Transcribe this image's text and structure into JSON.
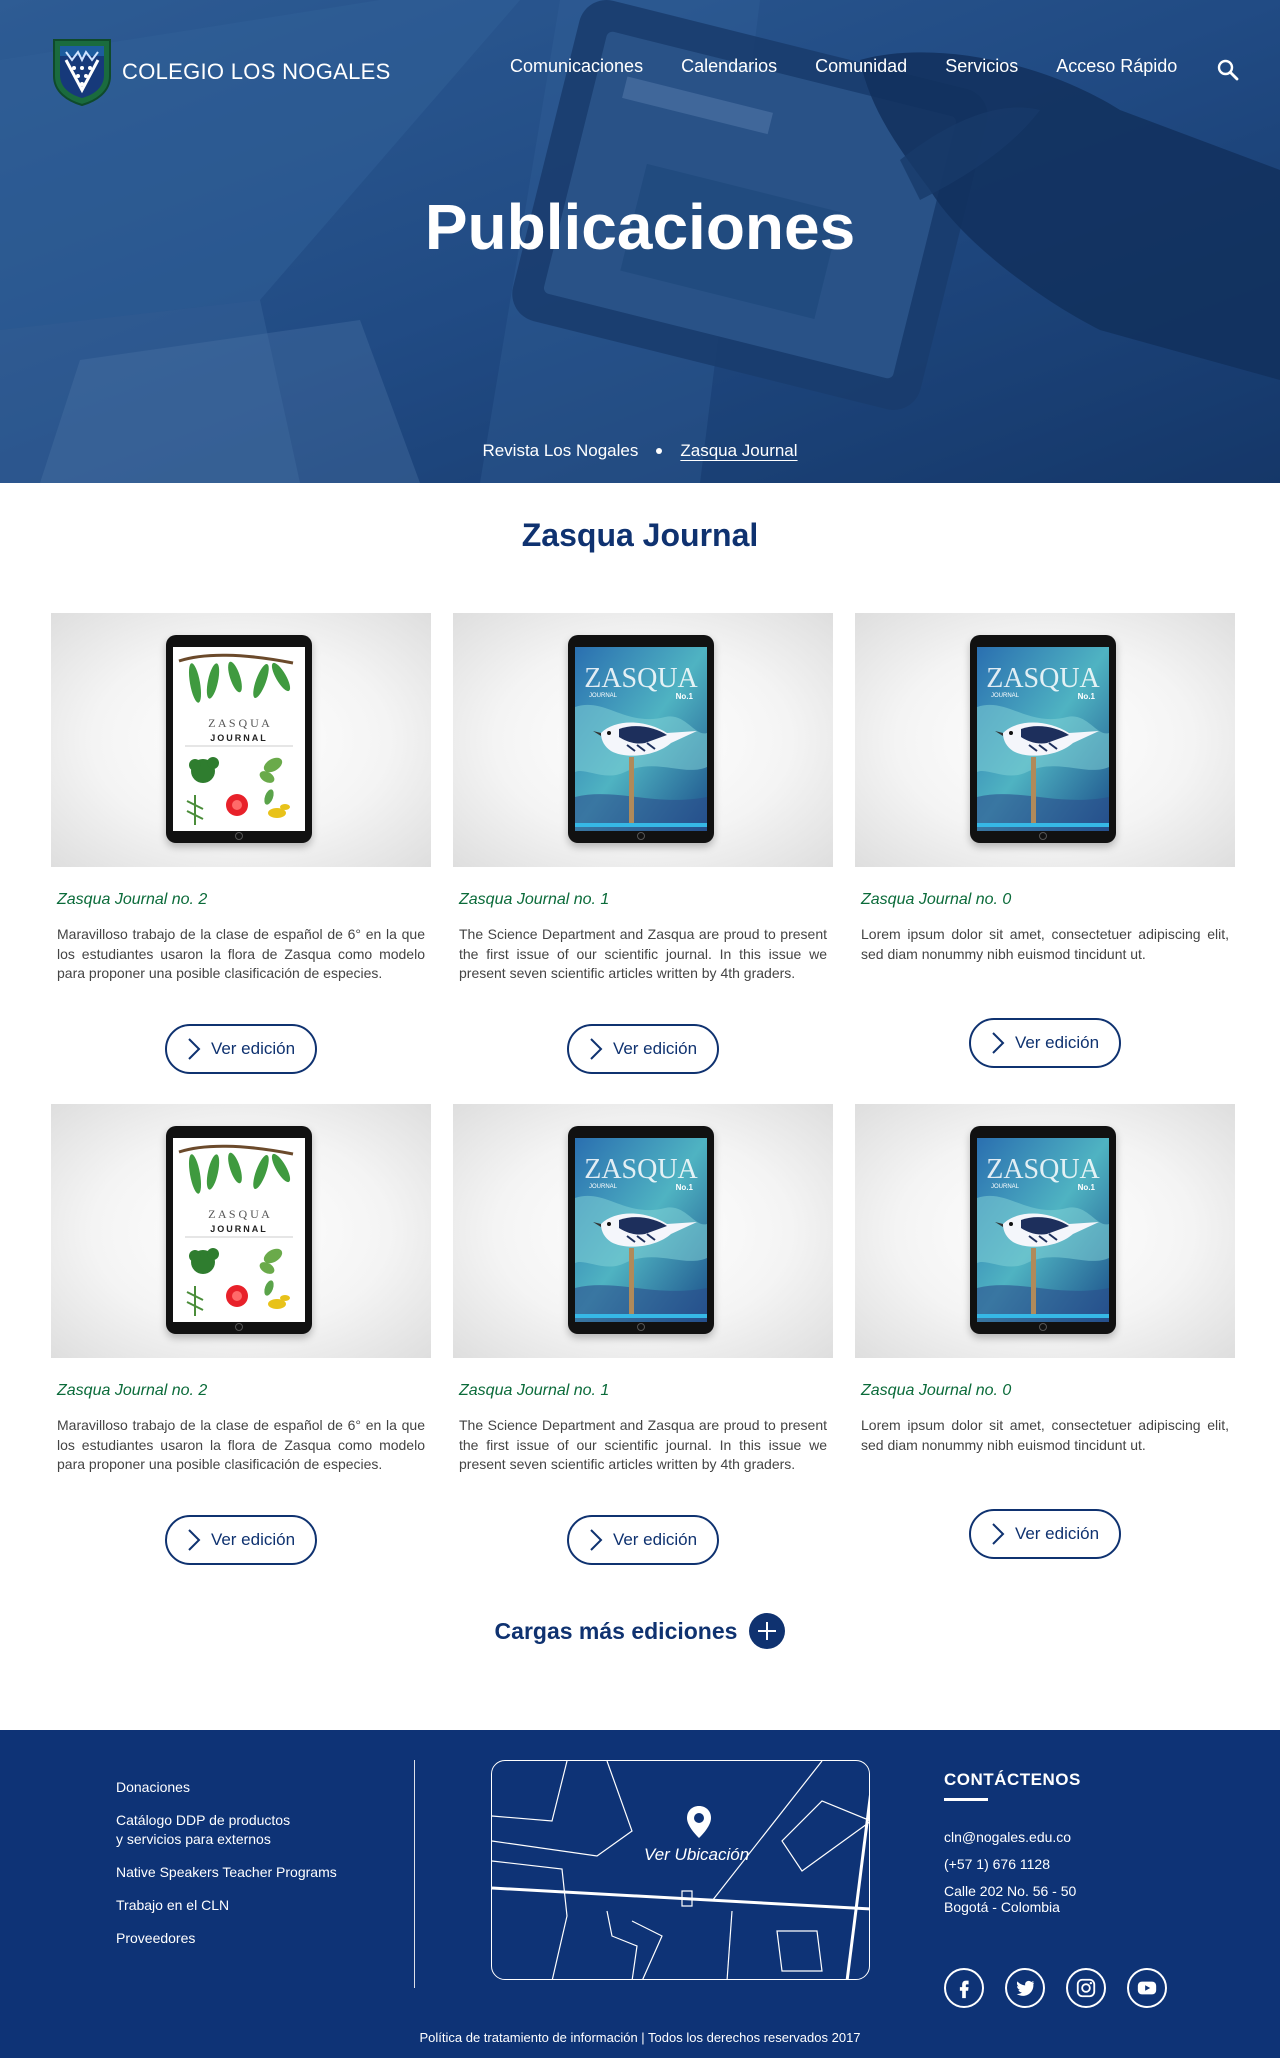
{
  "header": {
    "logo_text": "COLEGIO LOS NOGALES",
    "nav": [
      "Comunicaciones",
      "Calendarios",
      "Comunidad",
      "Servicios",
      "Acceso Rápido"
    ],
    "title": "Publicaciones",
    "breadcrumb": [
      "Revista Los Nogales",
      "Zasqua Journal"
    ],
    "brand_color": "#0e3376"
  },
  "main": {
    "section_title": "Zasqua Journal",
    "cards": [
      {
        "name": "Zasqua Journal no. 2",
        "desc": "Maravilloso trabajo de la clase de español de 6° en la que los estudiantes usaron la flora de Zasqua como modelo para proponer una posible clasificación de especies.",
        "button": "Ver edición",
        "cover": "plants"
      },
      {
        "name": "Zasqua Journal no. 1",
        "desc": "The Science Department and Zasqua are proud to present the first issue of our scientific journal. In this issue we present seven scientific articles written by 4th graders.",
        "button": "Ver edición",
        "cover": "bird"
      },
      {
        "name": "Zasqua Journal no. 0",
        "desc": "Lorem ipsum dolor sit amet, consectetuer adipiscing elit, sed diam nonummy nibh euismod tincidunt ut.",
        "button": "Ver edición",
        "cover": "bird"
      },
      {
        "name": "Zasqua Journal no. 2",
        "desc": "Maravilloso trabajo de la clase de español de 6° en la que los estudiantes usaron la flora de Zasqua como modelo para proponer una posible clasificación de especies.",
        "button": "Ver edición",
        "cover": "plants"
      },
      {
        "name": "Zasqua Journal no. 1",
        "desc": "The Science Department and Zasqua are proud to present the first issue of our scientific journal. In this issue we present seven scientific articles written by 4th graders.",
        "button": "Ver edición",
        "cover": "bird"
      },
      {
        "name": "Zasqua Journal no. 0",
        "desc": "Lorem ipsum dolor sit amet, consectetuer adipiscing elit, sed diam nonummy nibh euismod tincidunt ut.",
        "button": "Ver edición",
        "cover": "bird"
      }
    ],
    "cover_text": {
      "plants_title": "Z A S Q U A",
      "plants_subtitle": "JOURNAL",
      "bird_title": "ZASQUA",
      "bird_subtitle": "JOURNAL",
      "bird_issue": "No.1"
    },
    "load_more": "Cargas más ediciones"
  },
  "footer": {
    "links": [
      "Donaciones",
      "Catálogo DDP de productos\ny servicios para externos",
      "Native Speakers Teacher Programs",
      "Trabajo en el CLN",
      "Proveedores"
    ],
    "map_label": "Ver Ubicación",
    "contact_title": "CONTÁCTENOS",
    "email": "cln@nogales.edu.co",
    "phone": "(+57 1) 676 1128",
    "address": "Calle 202 No. 56 - 50\nBogotá - Colombia",
    "socials": [
      "facebook-icon",
      "twitter-icon",
      "instagram-icon",
      "youtube-icon"
    ],
    "copyright": "Política de tratamiento de información | Todos los derechos reservados 2017"
  }
}
